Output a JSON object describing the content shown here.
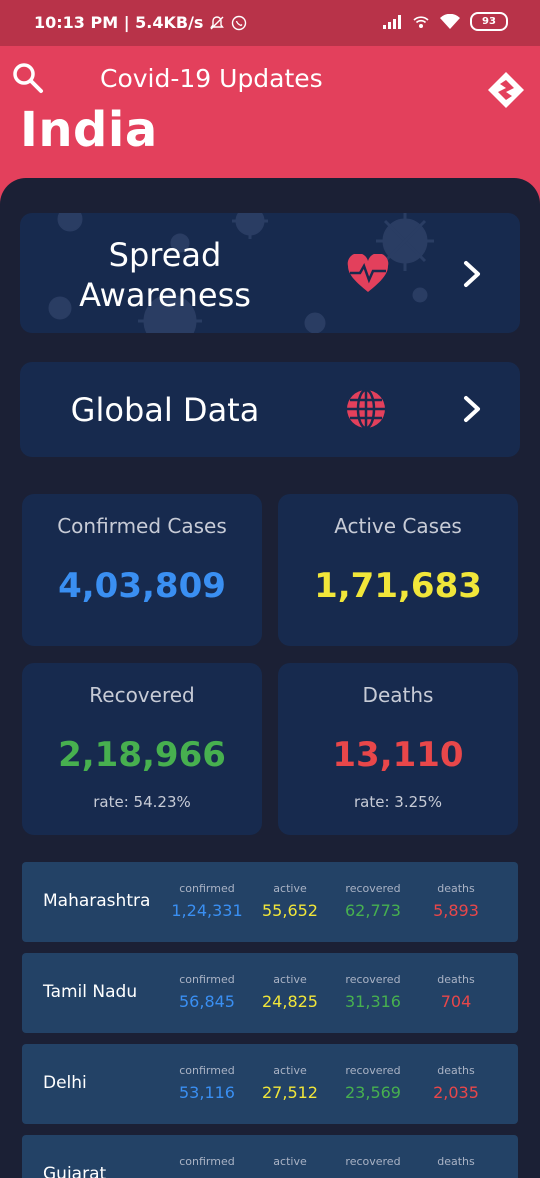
{
  "status_bar": {
    "time_speed": "10:13 PM | 5.4KB/s",
    "battery": "93"
  },
  "header": {
    "title": "Covid-19 Updates",
    "country": "India"
  },
  "awareness_card": {
    "title": "Spread Awareness"
  },
  "global_card": {
    "title": "Global Data"
  },
  "stats": {
    "confirmed": {
      "label": "Confirmed Cases",
      "value": "4,03,809"
    },
    "active": {
      "label": "Active Cases",
      "value": "1,71,683"
    },
    "recovered": {
      "label": "Recovered",
      "value": "2,18,966",
      "rate": "rate: 54.23%"
    },
    "deaths": {
      "label": "Deaths",
      "value": "13,110",
      "rate": "rate: 3.25%"
    }
  },
  "table_headers": {
    "confirmed": "confirmed",
    "active": "active",
    "recovered": "recovered",
    "deaths": "deaths"
  },
  "states": [
    {
      "name": "Maharashtra",
      "confirmed": "1,24,331",
      "active": "55,652",
      "recovered": "62,773",
      "deaths": "5,893"
    },
    {
      "name": "Tamil Nadu",
      "confirmed": "56,845",
      "active": "24,825",
      "recovered": "31,316",
      "deaths": "704"
    },
    {
      "name": "Delhi",
      "confirmed": "53,116",
      "active": "27,512",
      "recovered": "23,569",
      "deaths": "2,035"
    },
    {
      "name": "Gujarat",
      "confirmed": "",
      "active": "",
      "recovered": "",
      "deaths": ""
    }
  ],
  "colors": {
    "accent": "#e3405c",
    "confirmed": "#3a8ff2",
    "active": "#f1e63a",
    "recovered": "#47b04f",
    "deaths": "#e8474a",
    "background": "#1b2035",
    "card": "#172a4e"
  }
}
